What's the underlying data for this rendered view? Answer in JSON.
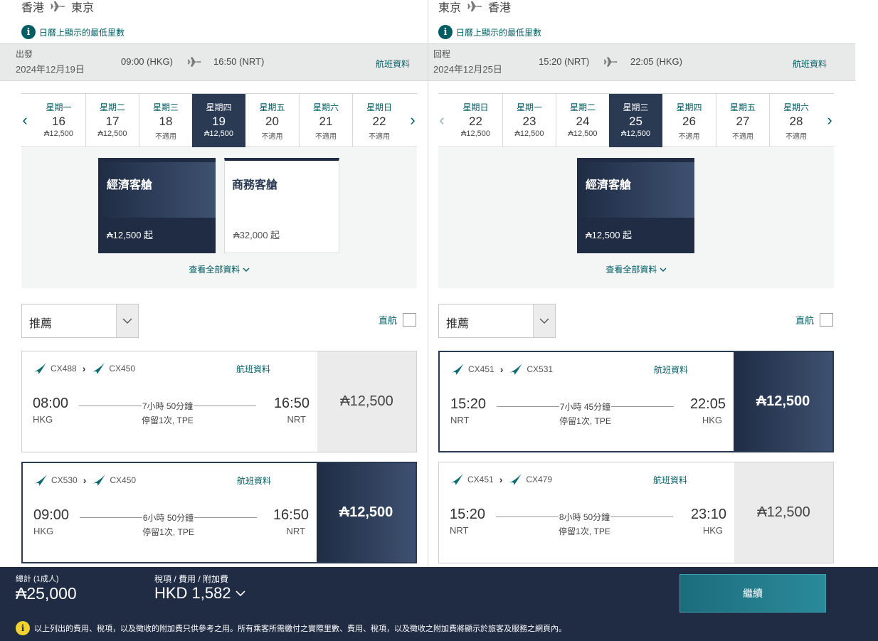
{
  "outbound": {
    "route": {
      "from": "香港",
      "to": "東京"
    },
    "calendar_note": "日曆上顯示的最低里數",
    "leg": {
      "type": "出發",
      "date": "2024年12月19日",
      "dep": "09:00 (HKG)",
      "arr": "16:50 (NRT)",
      "link": "航班資料"
    },
    "dates": [
      {
        "weekday": "星期一",
        "day": "16",
        "price": "₳12,500",
        "selected": false
      },
      {
        "weekday": "星期二",
        "day": "17",
        "price": "₳12,500",
        "selected": false
      },
      {
        "weekday": "星期三",
        "day": "18",
        "price": "不適用",
        "selected": false
      },
      {
        "weekday": "星期四",
        "day": "19",
        "price": "₳12,500",
        "selected": true
      },
      {
        "weekday": "星期五",
        "day": "20",
        "price": "不適用",
        "selected": false
      },
      {
        "weekday": "星期六",
        "day": "21",
        "price": "不適用",
        "selected": false
      },
      {
        "weekday": "星期日",
        "day": "22",
        "price": "不適用",
        "selected": false
      }
    ],
    "cabins": [
      {
        "name": "經濟客艙",
        "price": "₳12,500 起",
        "selected": true
      },
      {
        "name": "商務客艙",
        "price": "₳32,000 起",
        "selected": false
      }
    ],
    "view_all": "查看全部資料",
    "sort": "推薦",
    "direct": "直航",
    "flights": [
      {
        "f1": "CX488",
        "f2": "CX450",
        "link": "航班資料",
        "dep": "08:00",
        "dep_ap": "HKG",
        "arr": "16:50",
        "arr_ap": "NRT",
        "duration": "7小時 50分鐘",
        "stops": "停留1次, TPE",
        "price": "₳12,500",
        "selected": false
      },
      {
        "f1": "CX530",
        "f2": "CX450",
        "link": "航班資料",
        "dep": "09:00",
        "dep_ap": "HKG",
        "arr": "16:50",
        "arr_ap": "NRT",
        "duration": "6小時 50分鐘",
        "stops": "停留1次, TPE",
        "price": "₳12,500",
        "selected": true
      }
    ]
  },
  "inbound": {
    "route": {
      "from": "東京",
      "to": "香港"
    },
    "calendar_note": "日曆上顯示的最低里數",
    "leg": {
      "type": "回程",
      "date": "2024年12月25日",
      "dep": "15:20 (NRT)",
      "arr": "22:05 (HKG)",
      "link": "航班資料"
    },
    "dates": [
      {
        "weekday": "星期日",
        "day": "22",
        "price": "₳12,500",
        "selected": false
      },
      {
        "weekday": "星期一",
        "day": "23",
        "price": "₳12,500",
        "selected": false
      },
      {
        "weekday": "星期二",
        "day": "24",
        "price": "₳12,500",
        "selected": false
      },
      {
        "weekday": "星期三",
        "day": "25",
        "price": "₳12,500",
        "selected": true
      },
      {
        "weekday": "星期四",
        "day": "26",
        "price": "不適用",
        "selected": false
      },
      {
        "weekday": "星期五",
        "day": "27",
        "price": "不適用",
        "selected": false
      },
      {
        "weekday": "星期六",
        "day": "28",
        "price": "不適用",
        "selected": false
      }
    ],
    "cabins": [
      {
        "name": "經濟客艙",
        "price": "₳12,500 起",
        "selected": true
      }
    ],
    "view_all": "查看全部資料",
    "sort": "推薦",
    "direct": "直航",
    "flights": [
      {
        "f1": "CX451",
        "f2": "CX531",
        "link": "航班資料",
        "dep": "15:20",
        "dep_ap": "NRT",
        "arr": "22:05",
        "arr_ap": "HKG",
        "duration": "7小時 45分鐘",
        "stops": "停留1次, TPE",
        "price": "₳12,500",
        "selected": true
      },
      {
        "f1": "CX451",
        "f2": "CX479",
        "link": "航班資料",
        "dep": "15:20",
        "dep_ap": "NRT",
        "arr": "23:10",
        "arr_ap": "HKG",
        "duration": "8小時 50分鐘",
        "stops": "停留1次, TPE",
        "price": "₳12,500",
        "selected": false
      }
    ]
  },
  "footer": {
    "total_label": "總計 (1成人)",
    "total": "₳25,000",
    "tax_label": "稅項 / 費用 / 附加費",
    "tax": "HKD 1,582",
    "continue": "繼續",
    "note": "以上列出的費用、稅項，以及徵收的附加費只供參考之用。所有乘客所需繳付之實際里數、費用、稅項，以及徵收之附加費將顯示於旅客及服務之網頁內。"
  },
  "colors": {
    "navy": "#1f2c44",
    "teal": "#005d63",
    "accent_yellow": "#f3d12f"
  }
}
